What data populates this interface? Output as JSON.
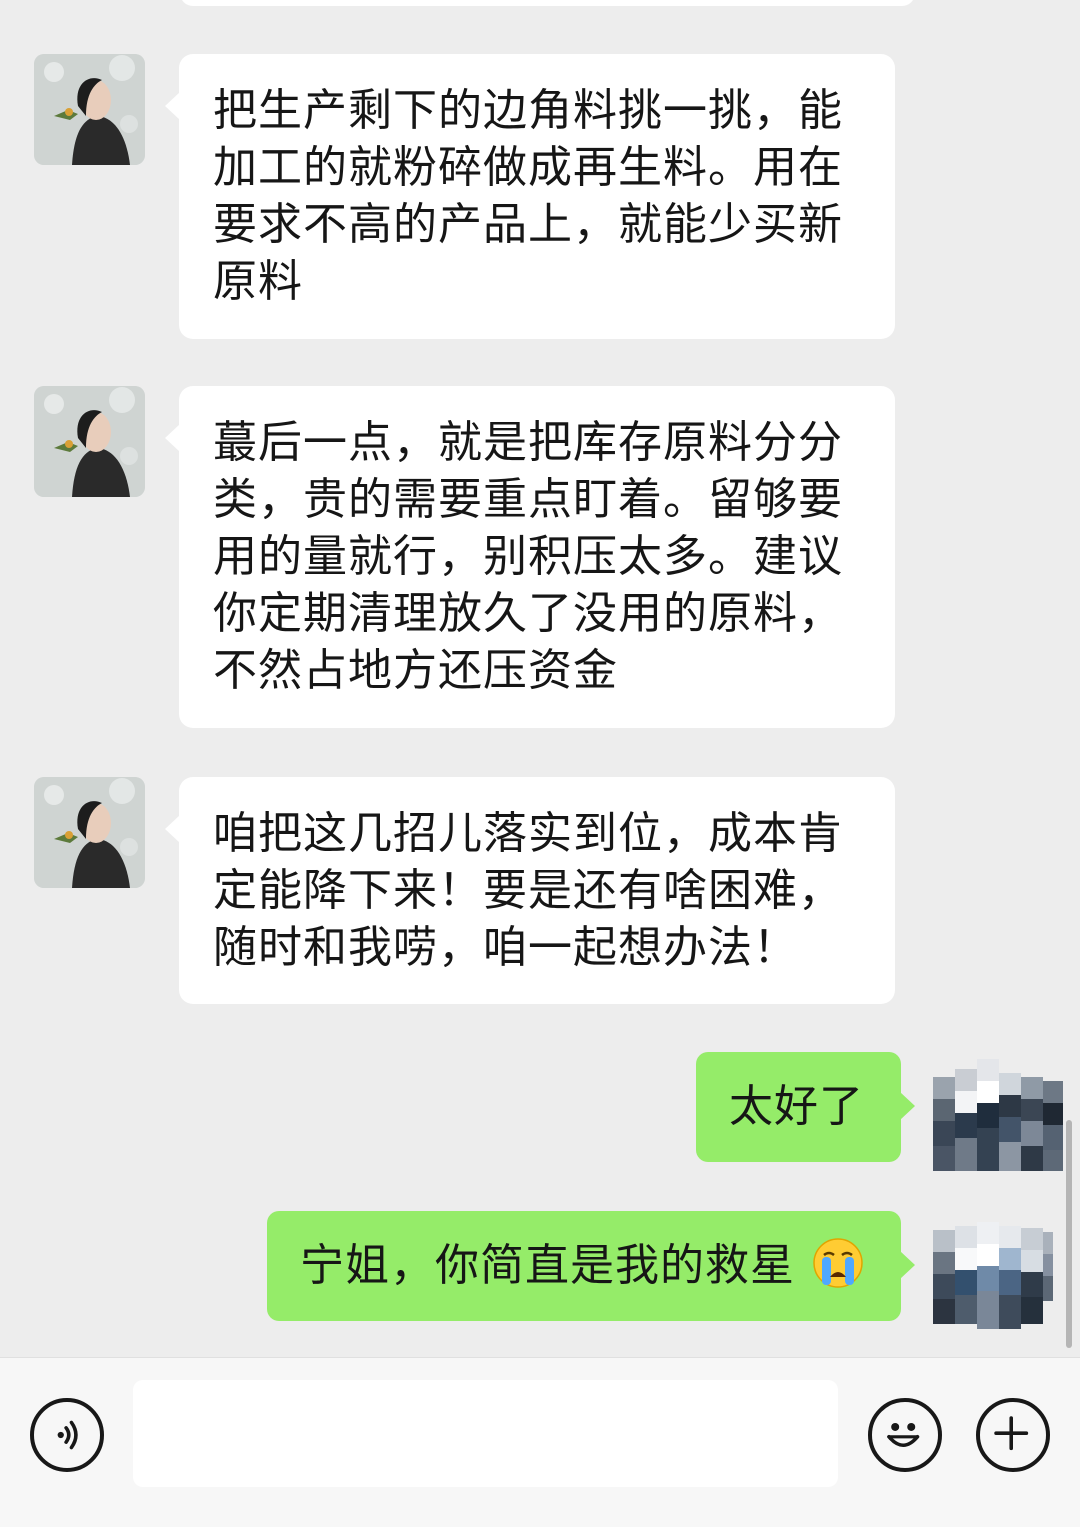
{
  "messages": [
    {
      "side": "left",
      "text": "把生产剩下的边角料挑一挑，能加工的就粉碎做成再生料。用在要求不高的产品上，就能少买新原料"
    },
    {
      "side": "left",
      "text": "蕞后一点，就是把库存原料分分类，贵的需要重点盯着。留够要用的量就行，别积压太多。建议你定期清理放久了没用的原料，不然占地方还压资金"
    },
    {
      "side": "left",
      "text": "咱把这几招儿落实到位，成本肯定能降下来！要是还有啥困难，随时和我唠，咱一起想办法！"
    },
    {
      "side": "right",
      "text": "太好了"
    },
    {
      "side": "right",
      "text": "宁姐，你简直是我的救星",
      "emoji": "loudly-crying-face"
    }
  ],
  "input_bar": {
    "voice_icon": "voice-icon",
    "emoji_icon": "smiley-icon",
    "plus_icon": "plus-icon",
    "input_value": ""
  },
  "colors": {
    "background": "#ededed",
    "left_bubble": "#ffffff",
    "right_bubble": "#95ec69",
    "input_bar": "#f7f7f7"
  }
}
